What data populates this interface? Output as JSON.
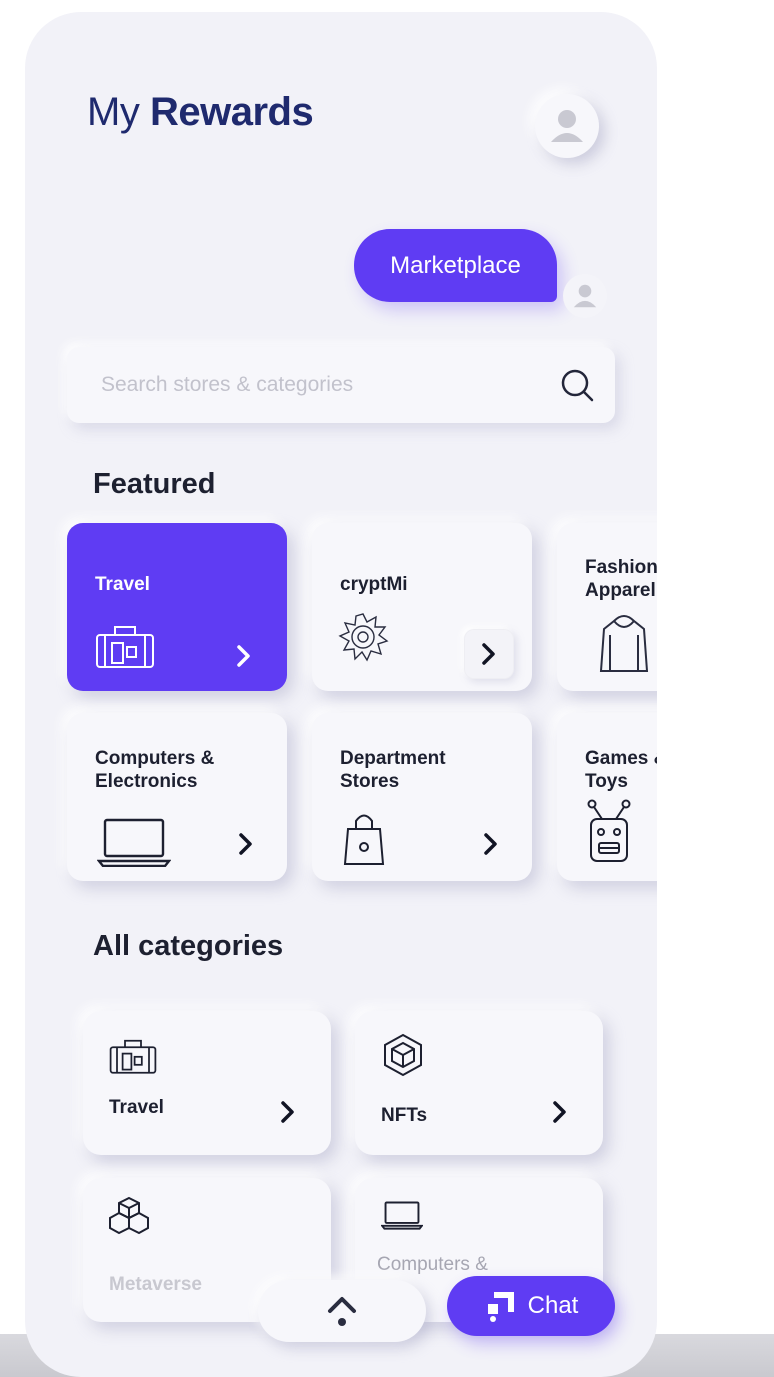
{
  "header": {
    "title_light": "My",
    "title_bold": "Rewards"
  },
  "marketplace_label": "Marketplace",
  "search": {
    "placeholder": "Search stores & categories"
  },
  "featured": {
    "heading": "Featured",
    "cards": [
      {
        "line1": "Travel",
        "line2": "",
        "icon": "suitcase-icon"
      },
      {
        "line1": "cryptMi",
        "line2": "",
        "icon": "crypto-logo-icon"
      },
      {
        "line1": "Fashion &",
        "line2": "Apparel",
        "icon": "hoodie-icon"
      },
      {
        "line1": "Computers &",
        "line2": "Electronics",
        "icon": "laptop-icon"
      },
      {
        "line1": "Department",
        "line2": "Stores",
        "icon": "shopping-bag-icon"
      },
      {
        "line1": "Games &",
        "line2": "Toys",
        "icon": "robot-icon"
      }
    ]
  },
  "all_categories": {
    "heading": "All categories",
    "cards": [
      {
        "label": "Travel",
        "icon": "suitcase-icon"
      },
      {
        "label": "NFTs",
        "icon": "cube-icon"
      },
      {
        "label": "Metaverse",
        "icon": "cubes-icon"
      },
      {
        "label": "Computers &",
        "icon": "laptop-icon"
      }
    ]
  },
  "chat_label": "Chat",
  "colors": {
    "accent": "#5f3cf3",
    "title": "#1f2a6e",
    "background": "#f2f2f8"
  }
}
